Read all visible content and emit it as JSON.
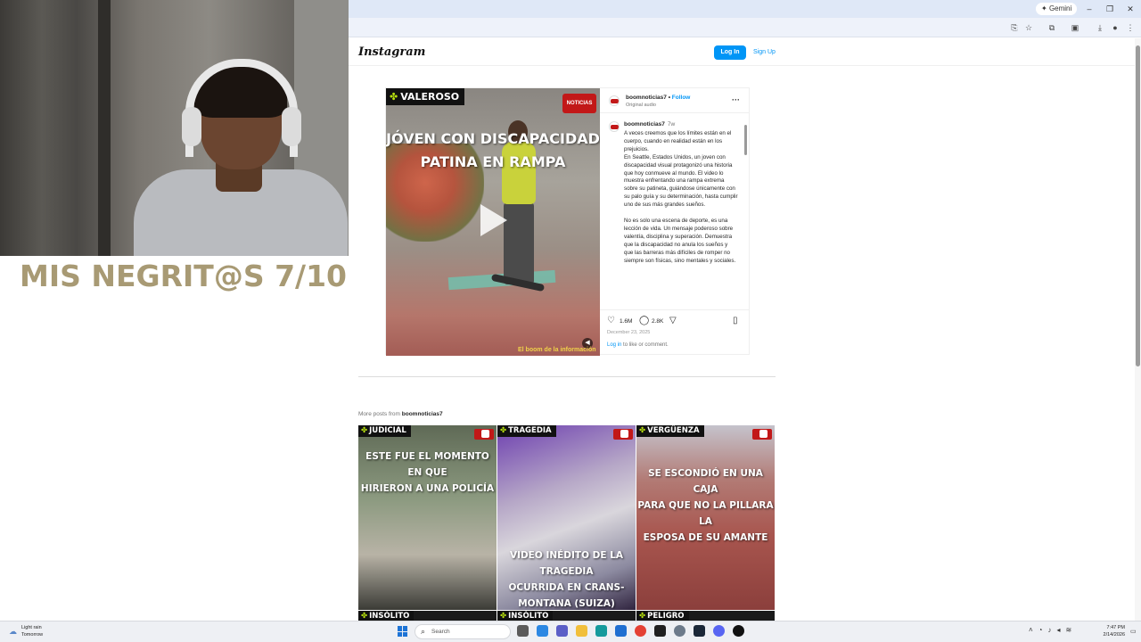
{
  "overlay": {
    "caption": "MIS NEGRIT@S 7/10"
  },
  "browser": {
    "gemini_label": "Gemini",
    "window_controls": [
      "–",
      "❐",
      "✕"
    ],
    "toolbar_icons": [
      "install-icon",
      "star-icon",
      "extensions-icon",
      "sidebar-icon",
      "profile-icon",
      "menu-icon"
    ]
  },
  "instagram": {
    "logo": "Instagram",
    "login_label": "Log In",
    "signup_label": "Sign Up",
    "post": {
      "video": {
        "tag": "VALEROSO",
        "brand": "NOTICIAS",
        "headline_line1": "JÓVEN CON DISCAPACIDAD",
        "headline_line2": "PATINA EN RAMPA",
        "watermark": "El boom de la información"
      },
      "username": "boomnoticias7",
      "follow_label": "Follow",
      "separator": "•",
      "audio": "Original audio",
      "caption_time": "7w",
      "caption": "A veces creemos que los límites están en el cuerpo, cuando en realidad están en los prejuicios.\nEn Seattle, Estados Unidos, un joven con discapacidad visual protagonizó una historia que hoy conmueve al mundo. El video lo muestra enfrentando una rampa extrema sobre su patineta, guiándose únicamente con su palo guía y su determinación, hasta cumplir uno de sus más grandes sueños.\n\nNo es solo una escena de deporte, es una lección de vida. Un mensaje poderoso sobre valentía, disciplina y superación. Demuestra que la discapacidad no anula los sueños y que las barreras más difíciles de romper no siempre son físicas, sino mentales y sociales.",
      "likes": "1.6M",
      "comments": "2.8K",
      "date": "December 23, 2025",
      "login_link": "Log in",
      "login_suffix": " to like or comment."
    },
    "more_posts_prefix": "More posts from ",
    "more_posts_user": "boomnoticias7",
    "grid": [
      {
        "tag": "JUDICIAL",
        "headline": "ESTE FUE EL MOMENTO EN QUE\nHIRIERON A UNA POLICÍA",
        "headline_pos": "top",
        "theme": "#7f8a73"
      },
      {
        "tag": "TRAGEDIA",
        "headline": "VIDEO INÉDITO DE LA TRAGEDIA\nOCURRIDA EN CRANS-\nMONTANA (SUIZA)",
        "headline_pos": "bottom",
        "theme": "#6b5b9a"
      },
      {
        "tag": "VERGÜENZA",
        "headline": "SE ESCONDIÓ EN UNA CAJA\nPARA QUE NO LA PILLARA LA\nESPOSA DE SU AMANTE",
        "headline_pos": "top",
        "theme": "#b0625c"
      }
    ],
    "grid_row2": [
      "INSÓLITO",
      "INSÓLITO",
      "PELIGRO"
    ]
  },
  "taskbar": {
    "weather_line1": "Light rain",
    "weather_line2": "Tomorrow",
    "search_placeholder": "Search",
    "time": "7:47 PM",
    "date": "2/14/2026"
  }
}
